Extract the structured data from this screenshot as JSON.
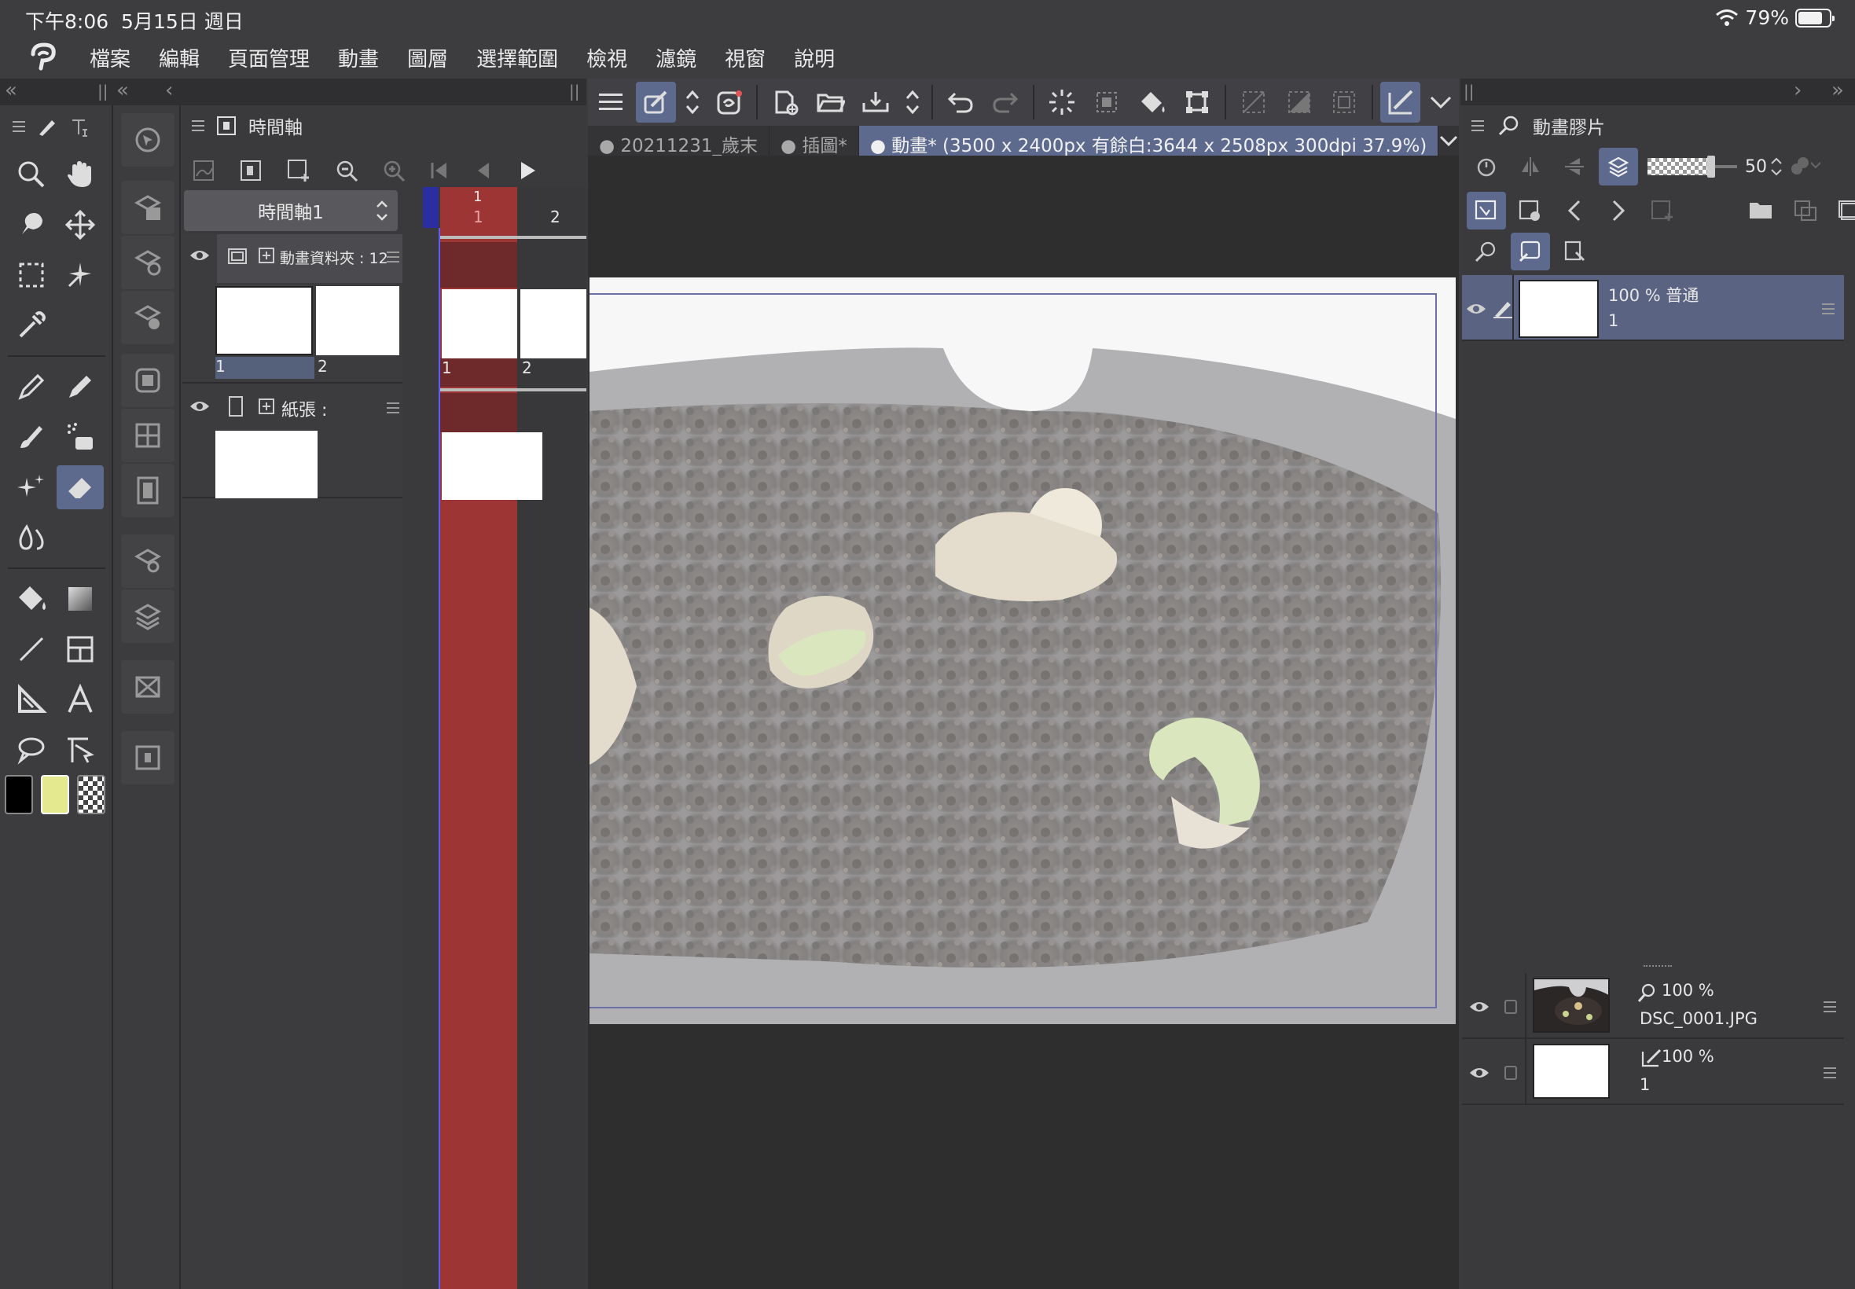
{
  "status": {
    "time": "下午8:06",
    "date": "5月15日 週日",
    "battery": "79%",
    "battery_level": 0.79
  },
  "menu": [
    "檔案",
    "編輯",
    "頁面管理",
    "動畫",
    "圖層",
    "選擇範圍",
    "檢視",
    "濾鏡",
    "視窗",
    "說明"
  ],
  "doc_tabs": [
    {
      "label": "20211231_歲末",
      "active": false
    },
    {
      "label": "插圖*",
      "active": false
    },
    {
      "label": "動畫* (3500 x 2400px 有餘白:3644 x 2508px 300dpi 37.9%)",
      "active": true
    }
  ],
  "timeline": {
    "title": "時間軸",
    "name": "時間軸1",
    "current_frame": "1",
    "frame_numbers": [
      "1",
      "2"
    ],
    "tracks": [
      {
        "label": "動畫資料夾 : 12",
        "cels": [
          "1",
          "2"
        ]
      },
      {
        "label": "紙張 :"
      }
    ]
  },
  "animation_cels": {
    "title": "動畫膠片",
    "opacity": "50",
    "layers": [
      {
        "opacity_mode": "100 % 普通",
        "name": "1",
        "selected": true
      }
    ]
  },
  "layers": [
    {
      "opacity": "100 %",
      "name": "DSC_0001.JPG"
    },
    {
      "opacity": "100 %",
      "name": "1"
    }
  ],
  "colors": {
    "accent": "#5d6a8e",
    "frame_red": "#9e3535",
    "main_color": "#000000",
    "sub_color": "#e4e98f"
  }
}
